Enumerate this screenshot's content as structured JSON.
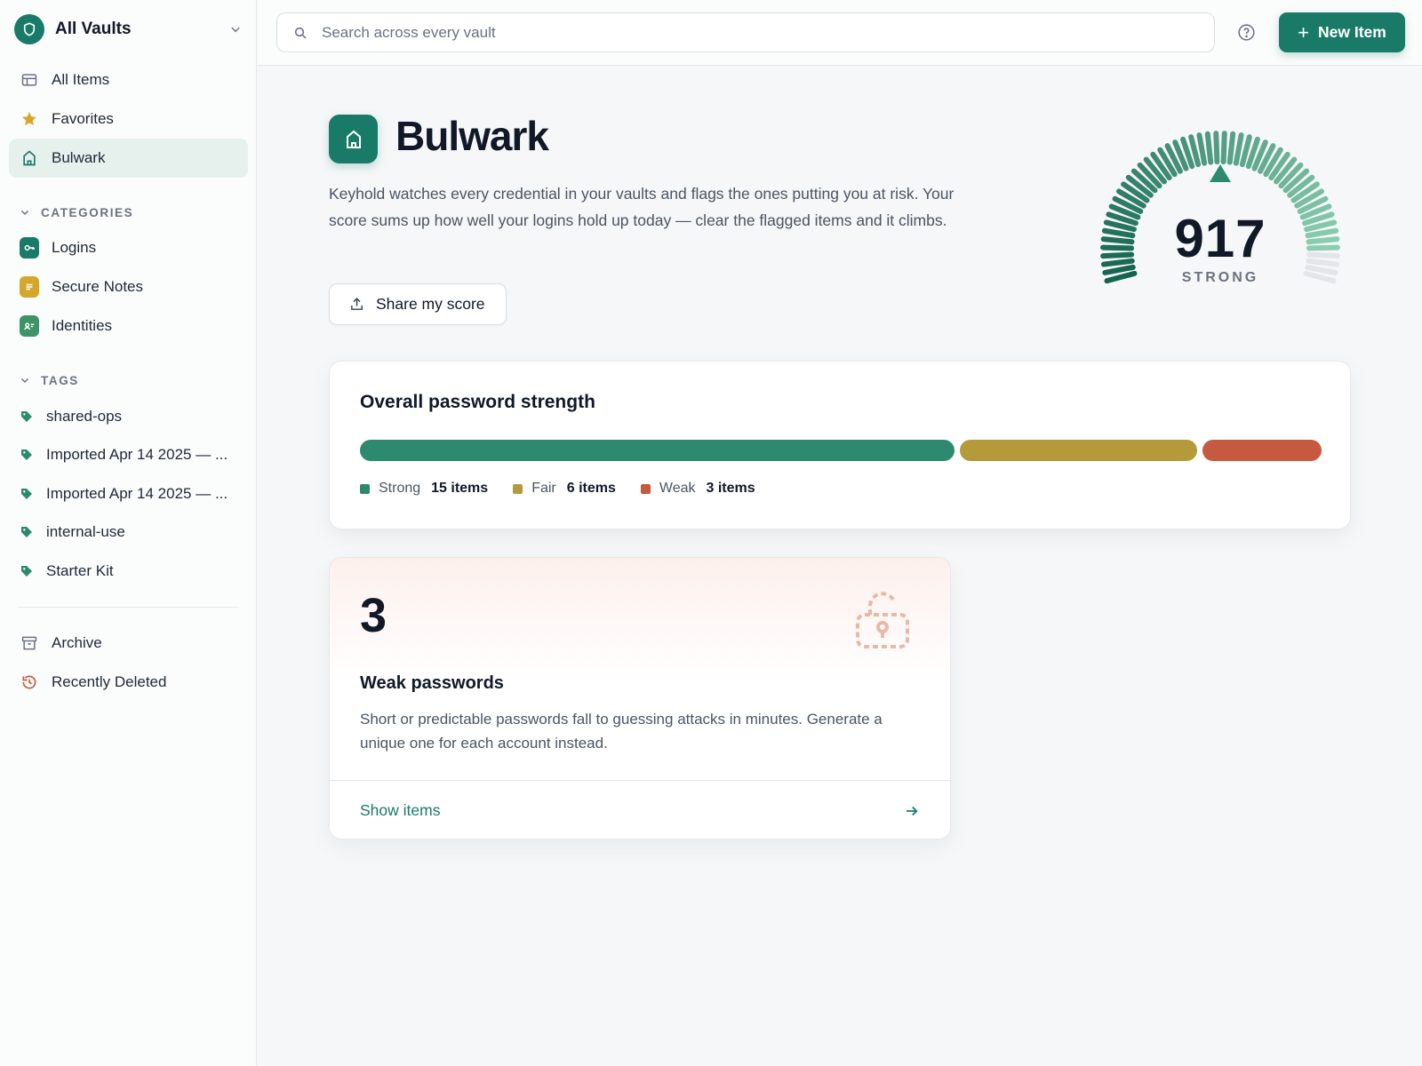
{
  "sidebar": {
    "vault_switcher": "All Vaults",
    "nav": [
      {
        "label": "All Items"
      },
      {
        "label": "Favorites"
      },
      {
        "label": "Bulwark"
      }
    ],
    "categories_label": "CATEGORIES",
    "categories": [
      {
        "label": "Logins",
        "color": "#1a7a68"
      },
      {
        "label": "Secure Notes",
        "color": "#d4a72c"
      },
      {
        "label": "Identities",
        "color": "#3d9466"
      }
    ],
    "tags_label": "TAGS",
    "tags": [
      {
        "label": "shared-ops"
      },
      {
        "label": "Imported Apr 14 2025 — ..."
      },
      {
        "label": "Imported Apr 14 2025 — ..."
      },
      {
        "label": "internal-use"
      },
      {
        "label": "Starter Kit"
      }
    ],
    "bottom": [
      {
        "label": "Archive"
      },
      {
        "label": "Recently Deleted"
      }
    ]
  },
  "topbar": {
    "search_placeholder": "Search across every vault",
    "new_button": "New Item"
  },
  "vault": {
    "title": "Bulwark",
    "description": "Keyhold watches every credential in your vaults and flags the ones putting you at risk. Your score sums up how well your logins hold up today — clear the flagged items and it climbs.",
    "share_button": "Share my score",
    "score": "917",
    "score_value": 917,
    "score_max": 1000,
    "score_label": "STRONG"
  },
  "strength": {
    "title": "Overall password strength",
    "segments": [
      {
        "name": "Strong",
        "count": 15,
        "count_label": "15 items",
        "color": "#2d8a6e"
      },
      {
        "name": "Fair",
        "count": 6,
        "count_label": "6 items",
        "color": "#b49a3a"
      },
      {
        "name": "Weak",
        "count": 3,
        "count_label": "3 items",
        "color": "#c55a40"
      }
    ]
  },
  "weak_card": {
    "count": "3",
    "title": "Weak passwords",
    "description": "Short or predictable passwords fall to guessing attacks in minutes. Generate a unique one for each account instead.",
    "link": "Show items"
  },
  "colors": {
    "accent": "#1a7a68",
    "strong": "#2d8a6e",
    "fair": "#b49a3a",
    "weak": "#c55a40"
  }
}
